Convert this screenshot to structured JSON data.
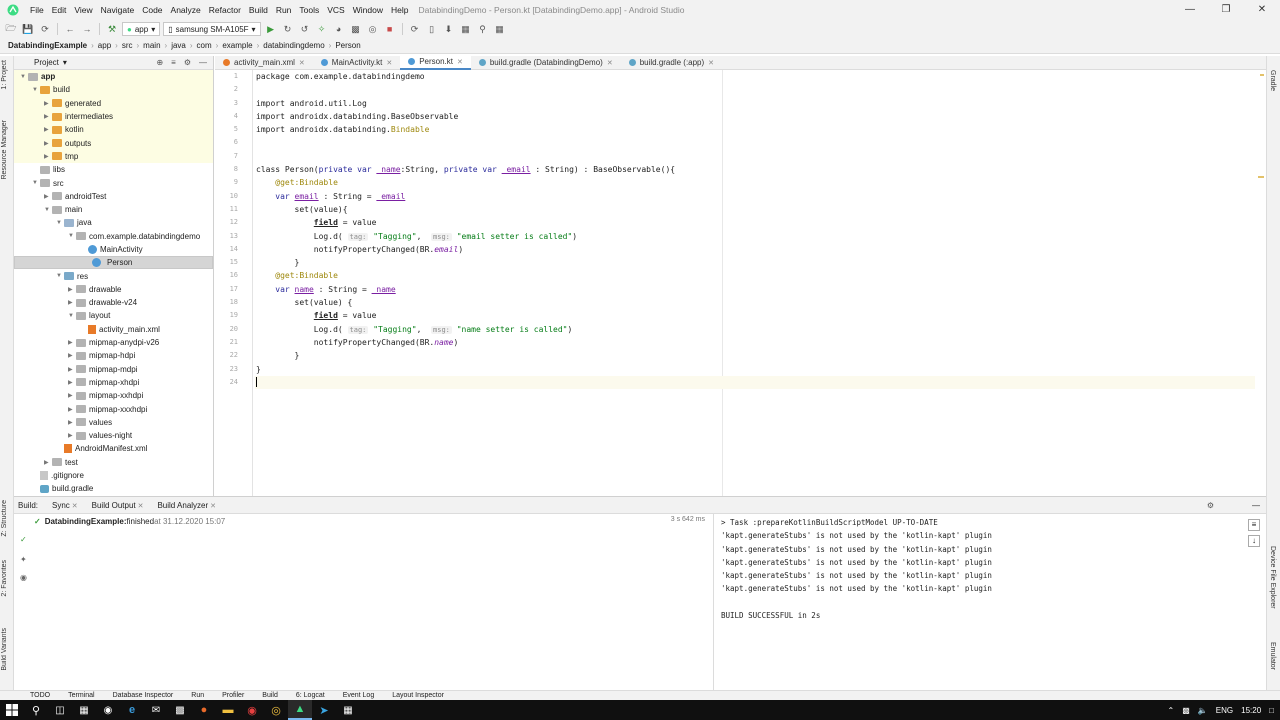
{
  "menu": [
    "File",
    "Edit",
    "View",
    "Navigate",
    "Code",
    "Analyze",
    "Refactor",
    "Build",
    "Run",
    "Tools",
    "VCS",
    "Window",
    "Help"
  ],
  "window_title": "DatabindingDemo - Person.kt [DatabindingDemo.app] - Android Studio",
  "toolbar": {
    "config": "app",
    "device": "samsung SM-A105F"
  },
  "breadcrumbs": [
    "DatabindingExample",
    "app",
    "src",
    "main",
    "java",
    "com",
    "example",
    "databindingdemo",
    "Person"
  ],
  "project": {
    "view_label": "Project",
    "tree": [
      {
        "label": "app",
        "depth": 0,
        "type": "module",
        "open": true,
        "hl": true
      },
      {
        "label": "build",
        "depth": 1,
        "type": "orange",
        "open": true,
        "hl": true
      },
      {
        "label": "generated",
        "depth": 2,
        "type": "orange",
        "open": false,
        "hl": true
      },
      {
        "label": "intermediates",
        "depth": 2,
        "type": "orange",
        "open": false,
        "hl": true
      },
      {
        "label": "kotlin",
        "depth": 2,
        "type": "orange",
        "open": false,
        "hl": true
      },
      {
        "label": "outputs",
        "depth": 2,
        "type": "orange",
        "open": false,
        "hl": true
      },
      {
        "label": "tmp",
        "depth": 2,
        "type": "orange",
        "open": false,
        "hl": true
      },
      {
        "label": "libs",
        "depth": 1,
        "type": "grey",
        "open": null
      },
      {
        "label": "src",
        "depth": 1,
        "type": "grey",
        "open": true
      },
      {
        "label": "androidTest",
        "depth": 2,
        "type": "grey",
        "open": false
      },
      {
        "label": "main",
        "depth": 2,
        "type": "grey",
        "open": true
      },
      {
        "label": "java",
        "depth": 3,
        "type": "blue",
        "open": true
      },
      {
        "label": "com.example.databindingdemo",
        "depth": 4,
        "type": "grey",
        "open": true
      },
      {
        "label": "MainActivity",
        "depth": 5,
        "type": "kotlin"
      },
      {
        "label": "Person",
        "depth": 5,
        "type": "kotlin",
        "selected": true
      },
      {
        "label": "res",
        "depth": 3,
        "type": "teal",
        "open": true
      },
      {
        "label": "drawable",
        "depth": 4,
        "type": "grey",
        "open": false
      },
      {
        "label": "drawable-v24",
        "depth": 4,
        "type": "grey",
        "open": false
      },
      {
        "label": "layout",
        "depth": 4,
        "type": "grey",
        "open": true
      },
      {
        "label": "activity_main.xml",
        "depth": 5,
        "type": "xml"
      },
      {
        "label": "mipmap-anydpi-v26",
        "depth": 4,
        "type": "grey",
        "open": false
      },
      {
        "label": "mipmap-hdpi",
        "depth": 4,
        "type": "grey",
        "open": false
      },
      {
        "label": "mipmap-mdpi",
        "depth": 4,
        "type": "grey",
        "open": false
      },
      {
        "label": "mipmap-xhdpi",
        "depth": 4,
        "type": "grey",
        "open": false
      },
      {
        "label": "mipmap-xxhdpi",
        "depth": 4,
        "type": "grey",
        "open": false
      },
      {
        "label": "mipmap-xxxhdpi",
        "depth": 4,
        "type": "grey",
        "open": false
      },
      {
        "label": "values",
        "depth": 4,
        "type": "grey",
        "open": false
      },
      {
        "label": "values-night",
        "depth": 4,
        "type": "grey",
        "open": false
      },
      {
        "label": "AndroidManifest.xml",
        "depth": 3,
        "type": "xml"
      },
      {
        "label": "test",
        "depth": 2,
        "type": "grey",
        "open": false
      },
      {
        "label": ".gitignore",
        "depth": 1,
        "type": "git"
      },
      {
        "label": "build.gradle",
        "depth": 1,
        "type": "gradle"
      }
    ]
  },
  "tabs": [
    {
      "label": "activity_main.xml",
      "active": false,
      "color": "#e87a28"
    },
    {
      "label": "MainActivity.kt",
      "active": false,
      "color": "#4f9ad6"
    },
    {
      "label": "Person.kt",
      "active": true,
      "color": "#4f9ad6"
    },
    {
      "label": "build.gradle (DatabindingDemo)",
      "active": false,
      "color": "#5fa5c7"
    },
    {
      "label": "build.gradle (:app)",
      "active": false,
      "color": "#5fa5c7"
    }
  ],
  "code": {
    "line_numbers": [
      "1",
      "2",
      "3",
      "4",
      "5",
      "6",
      "7",
      "8",
      "9",
      "10",
      "11",
      "12",
      "13",
      "14",
      "15",
      "16",
      "17",
      "18",
      "19",
      "20",
      "21",
      "22",
      "23",
      "24"
    ],
    "lines": [
      [
        {
          "t": "package com.example.databindingdemo",
          "c": "pl"
        }
      ],
      [],
      [
        {
          "t": "import android.util.Log",
          "c": "pl"
        }
      ],
      [
        {
          "t": "import androidx.databinding.BaseObservable",
          "c": "pl"
        }
      ],
      [
        {
          "t": "import androidx.databinding.",
          "c": "pl"
        },
        {
          "t": "Bindable",
          "c": "ann"
        }
      ],
      [],
      [],
      [
        {
          "t": "class Person(",
          "c": "pl"
        },
        {
          "t": "private var ",
          "c": "kw"
        },
        {
          "t": "_name",
          "c": "fld"
        },
        {
          "t": ":String, ",
          "c": "pl"
        },
        {
          "t": "private var ",
          "c": "kw"
        },
        {
          "t": "_email",
          "c": "fld"
        },
        {
          "t": " : String) : BaseObservable(){",
          "c": "pl"
        }
      ],
      [
        {
          "t": "    ",
          "c": "pl"
        },
        {
          "t": "@get:Bindable",
          "c": "ann"
        }
      ],
      [
        {
          "t": "    ",
          "c": "pl"
        },
        {
          "t": "var ",
          "c": "kw"
        },
        {
          "t": "email",
          "c": "fld"
        },
        {
          "t": " : String = ",
          "c": "pl"
        },
        {
          "t": "_email",
          "c": "fld"
        }
      ],
      [
        {
          "t": "        set(value){",
          "c": "pl"
        }
      ],
      [
        {
          "t": "            ",
          "c": "pl"
        },
        {
          "t": "field",
          "c": "fldb"
        },
        {
          "t": " = value",
          "c": "pl"
        }
      ],
      [
        {
          "t": "            Log.d( ",
          "c": "pl"
        },
        {
          "t": "tag:",
          "c": "hint"
        },
        {
          "t": " ",
          "c": "pl"
        },
        {
          "t": "\"Tagging\"",
          "c": "str"
        },
        {
          "t": ",  ",
          "c": "pl"
        },
        {
          "t": "msg:",
          "c": "hint"
        },
        {
          "t": " ",
          "c": "pl"
        },
        {
          "t": "\"email setter is called\"",
          "c": "str"
        },
        {
          "t": ")",
          "c": "pl"
        }
      ],
      [
        {
          "t": "            notifyPropertyChanged(BR.",
          "c": "pl"
        },
        {
          "t": "email",
          "c": "ital"
        },
        {
          "t": ")",
          "c": "pl"
        }
      ],
      [
        {
          "t": "        }",
          "c": "pl"
        }
      ],
      [
        {
          "t": "    ",
          "c": "pl"
        },
        {
          "t": "@get:Bindable",
          "c": "ann"
        }
      ],
      [
        {
          "t": "    ",
          "c": "pl"
        },
        {
          "t": "var ",
          "c": "kw"
        },
        {
          "t": "name",
          "c": "fld"
        },
        {
          "t": " : String = ",
          "c": "pl"
        },
        {
          "t": "_name",
          "c": "fld"
        }
      ],
      [
        {
          "t": "        set(value) {",
          "c": "pl"
        }
      ],
      [
        {
          "t": "            ",
          "c": "pl"
        },
        {
          "t": "field",
          "c": "fldb"
        },
        {
          "t": " = value",
          "c": "pl"
        }
      ],
      [
        {
          "t": "            Log.d( ",
          "c": "pl"
        },
        {
          "t": "tag:",
          "c": "hint"
        },
        {
          "t": " ",
          "c": "pl"
        },
        {
          "t": "\"Tagging\"",
          "c": "str"
        },
        {
          "t": ",  ",
          "c": "pl"
        },
        {
          "t": "msg:",
          "c": "hint"
        },
        {
          "t": " ",
          "c": "pl"
        },
        {
          "t": "\"name setter is called\"",
          "c": "str"
        },
        {
          "t": ")",
          "c": "pl"
        }
      ],
      [
        {
          "t": "            notifyPropertyChanged(BR.",
          "c": "pl"
        },
        {
          "t": "name",
          "c": "ital"
        },
        {
          "t": ")",
          "c": "pl"
        }
      ],
      [
        {
          "t": "        }",
          "c": "pl"
        }
      ],
      [
        {
          "t": "}",
          "c": "pl"
        }
      ],
      []
    ]
  },
  "build": {
    "label": "Build:",
    "tabs": [
      "Sync",
      "Build Output",
      "Build Analyzer"
    ],
    "status_project": "DatabindingExample:",
    "status_text": " finished",
    "status_time": " at 31.12.2020 15:07",
    "duration": "3 s 642 ms",
    "output": [
      "> Task :prepareKotlinBuildScriptModel UP-TO-DATE",
      "'kapt.generateStubs' is not used by the 'kotlin-kapt' plugin",
      "'kapt.generateStubs' is not used by the 'kotlin-kapt' plugin",
      "'kapt.generateStubs' is not used by the 'kotlin-kapt' plugin",
      "'kapt.generateStubs' is not used by the 'kotlin-kapt' plugin",
      "'kapt.generateStubs' is not used by the 'kotlin-kapt' plugin",
      "",
      "BUILD SUCCESSFUL in 2s"
    ]
  },
  "left_tools": [
    "1: Project",
    "Resource Manager",
    "Z: Structure",
    "2: Favorites",
    "Build Variants"
  ],
  "right_tools": [
    "Gradle",
    "Device File Explorer",
    "Emulator"
  ],
  "statusbar": [
    "TODO",
    "Terminal",
    "Database Inspector",
    "Run",
    "Profiler",
    "Build",
    "6: Logcat",
    "Event Log",
    "Layout Inspector"
  ],
  "taskbar": {
    "lang": "ENG",
    "time": "15:20"
  }
}
